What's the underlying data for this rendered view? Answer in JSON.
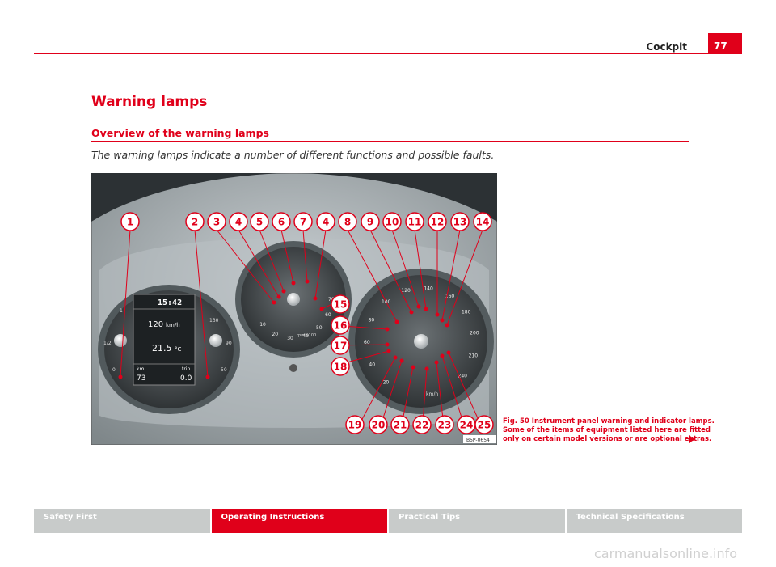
{
  "header": {
    "section": "Cockpit",
    "page": "77"
  },
  "heading": "Warning lamps",
  "subheading": "Overview of the warning lamps",
  "intro": "The warning lamps indicate a number of different functions and possible faults.",
  "figure": {
    "code": "B5P-0654",
    "callouts": [
      "1",
      "2",
      "3",
      "4",
      "5",
      "6",
      "7",
      "4",
      "8",
      "9",
      "10",
      "11",
      "12",
      "13",
      "14",
      "15",
      "16",
      "17",
      "18",
      "19",
      "20",
      "21",
      "22",
      "23",
      "24",
      "25"
    ],
    "display": {
      "time": "15:42",
      "avg_speed": "120",
      "speed_unit": "km/h",
      "temp": "21.5",
      "temp_unit": "°C",
      "km_label": "km",
      "km_value": "73",
      "trip_label": "trip",
      "trip_value": "0.0"
    },
    "rpm_label": "rpm x100",
    "speed_label": "km/h",
    "rpm_ticks": [
      "10",
      "20",
      "30",
      "40",
      "50",
      "60",
      "70"
    ],
    "speed_ticks": [
      "20",
      "40",
      "60",
      "80",
      "100",
      "120",
      "140",
      "160",
      "180",
      "200",
      "210",
      "240"
    ],
    "fuel_ticks": [
      "1/2",
      "1",
      "0"
    ],
    "temp_ticks": [
      "50",
      "90",
      "130"
    ]
  },
  "caption": {
    "lines": [
      "Fig. 50   Instrument panel warning and indicator lamps.",
      "Some of the items of equipment listed here are fitted",
      "only on certain model versions or are optional extras."
    ]
  },
  "footer": {
    "tabs": [
      "Safety First",
      "Operating Instructions",
      "Practical Tips",
      "Technical Specifications"
    ],
    "active_index": 1
  },
  "watermark": "carmanualsonline.info",
  "colors": {
    "accent": "#e0001a",
    "tab_inactive": "#c8cbca"
  }
}
